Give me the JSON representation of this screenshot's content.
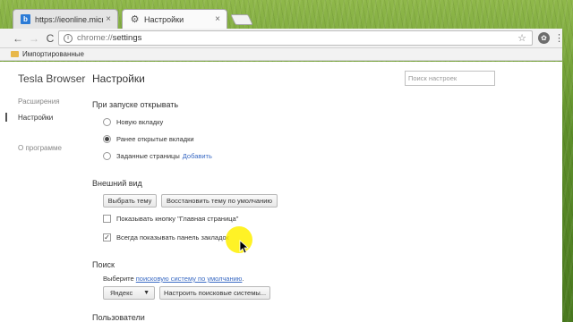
{
  "tabs": [
    {
      "title": "https://ieonline.microsoft",
      "icon": "bing-icon",
      "close": "×"
    },
    {
      "title": "Настройки",
      "icon": "gear-icon",
      "close": "×"
    }
  ],
  "toolbar": {
    "back": "←",
    "forward": "→",
    "reload": "C",
    "url_scheme": "chrome://",
    "url_path": "settings",
    "star": "☆",
    "menu": "⋮"
  },
  "bookmarks": {
    "folder_label": "Импортированные"
  },
  "sidebar": {
    "brand": "Tesla Browser",
    "items": [
      {
        "label": "Расширения"
      },
      {
        "label": "Настройки"
      },
      {
        "label": "О программе"
      }
    ]
  },
  "main": {
    "title": "Настройки",
    "search_placeholder": "Поиск настроек",
    "startup": {
      "heading": "При запуске открывать",
      "options": [
        {
          "label": "Новую вкладку",
          "selected": false
        },
        {
          "label": "Ранее открытые вкладки",
          "selected": true
        },
        {
          "label": "Заданные страницы",
          "link": "Добавить",
          "selected": false
        }
      ]
    },
    "appearance": {
      "heading": "Внешний вид",
      "choose_theme_button": "Выбрать тему",
      "reset_theme_button": "Восстановить тему по умолчанию",
      "show_home_button": {
        "label": "Показывать кнопку \"Главная страница\"",
        "checked": false
      },
      "show_bookmarks_bar": {
        "label": "Всегда показывать панель закладок",
        "checked": true
      }
    },
    "search": {
      "heading": "Поиск",
      "prefix_text": "Выберите ",
      "link_text": "поисковую систему по умолчанию",
      "suffix_text": ".",
      "engine_select": "Яндекс",
      "manage_button": "Настроить поисковые системы..."
    },
    "users": {
      "heading": "Пользователи"
    }
  },
  "colors": {
    "link": "#3b6bc4",
    "cursor_highlight": "#fff000"
  }
}
